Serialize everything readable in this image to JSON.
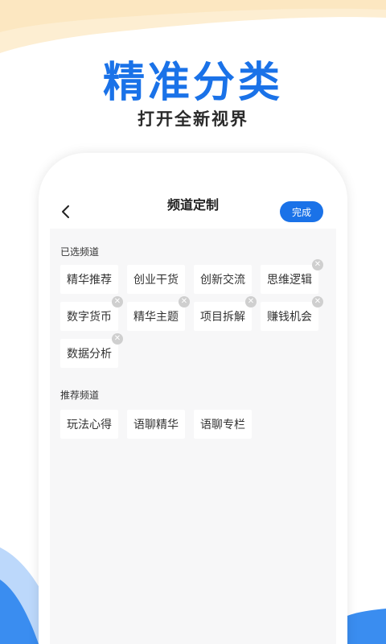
{
  "promo": {
    "title": "精准分类",
    "subtitle": "打开全新视界"
  },
  "colors": {
    "accent": "#1a72e8",
    "chip_bg": "#ffffff",
    "content_bg": "#f7f7f8",
    "remove_badge": "#cfcfcf",
    "top_wave": "#fdeed2",
    "bottom_wave": "#bcd8fb"
  },
  "nav": {
    "back_icon": "chevron-left-icon",
    "title": "频道定制",
    "done_label": "完成"
  },
  "selected": {
    "label": "已选频道",
    "items": [
      {
        "label": "精华推荐",
        "removable": false
      },
      {
        "label": "创业干货",
        "removable": false
      },
      {
        "label": "创新交流",
        "removable": false
      },
      {
        "label": "思维逻辑",
        "removable": true
      },
      {
        "label": "数字货币",
        "removable": true
      },
      {
        "label": "精华主题",
        "removable": true
      },
      {
        "label": "项目拆解",
        "removable": true
      },
      {
        "label": "赚钱机会",
        "removable": true
      },
      {
        "label": "数据分析",
        "removable": true
      }
    ]
  },
  "recommended": {
    "label": "推荐频道",
    "items": [
      {
        "label": "玩法心得"
      },
      {
        "label": "语聊精华"
      },
      {
        "label": "语聊专栏"
      }
    ]
  }
}
